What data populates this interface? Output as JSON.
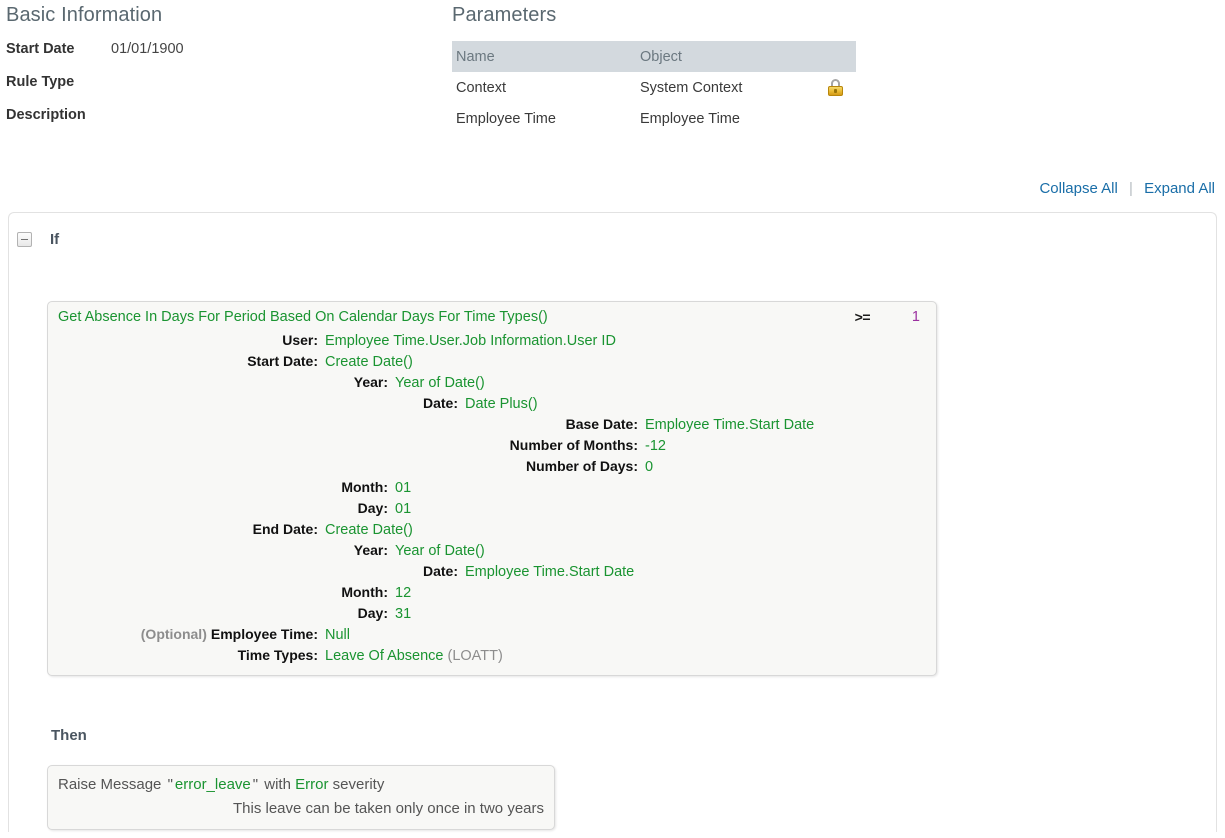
{
  "basic_information": {
    "title": "Basic Information",
    "rows": [
      {
        "label": "Start Date",
        "value": "01/01/1900"
      },
      {
        "label": "Rule Type",
        "value": ""
      },
      {
        "label": "Description",
        "value": ""
      }
    ]
  },
  "parameters": {
    "title": "Parameters",
    "columns": [
      "Name",
      "Object",
      ""
    ],
    "rows": [
      {
        "name": "Context",
        "object": "System Context",
        "locked": true,
        "lock_icon": "lock-icon"
      },
      {
        "name": "Employee Time",
        "object": "Employee Time",
        "locked": false,
        "lock_icon": ""
      }
    ]
  },
  "link_bar": {
    "collapse_all": "Collapse All",
    "expand_all": "Expand All",
    "divider": "|"
  },
  "rule": {
    "if_label": "If",
    "then_label": "Then",
    "toggle_icon": "minus-box-icon",
    "condition": {
      "function": "Get Absence In Days For Period Based On Calendar Days For Time Types()",
      "operator": ">=",
      "operand": "1",
      "args": [
        {
          "optional": "",
          "label": "User:",
          "value": "Employee Time.User.Job Information.User ID",
          "suffix": "",
          "indent": 0
        },
        {
          "optional": "",
          "label": "Start Date:",
          "value": "Create Date()",
          "suffix": "",
          "indent": 0
        },
        {
          "optional": "",
          "label": "Year:",
          "value": "Year of Date()",
          "suffix": "",
          "indent": 1
        },
        {
          "optional": "",
          "label": "Date:",
          "value": "Date Plus()",
          "suffix": "",
          "indent": 2
        },
        {
          "optional": "",
          "label": "Base Date:",
          "value": "Employee Time.Start Date",
          "suffix": "",
          "indent": 3
        },
        {
          "optional": "",
          "label": "Number of Months:",
          "value": "-12",
          "suffix": "",
          "indent": 3
        },
        {
          "optional": "",
          "label": "Number of Days:",
          "value": "0",
          "suffix": "",
          "indent": 3
        },
        {
          "optional": "",
          "label": "Month:",
          "value": "01",
          "suffix": "",
          "indent": 1
        },
        {
          "optional": "",
          "label": "Day:",
          "value": "01",
          "suffix": "",
          "indent": 1
        },
        {
          "optional": "",
          "label": "End Date:",
          "value": "Create Date()",
          "suffix": "",
          "indent": 0
        },
        {
          "optional": "",
          "label": "Year:",
          "value": "Year of Date()",
          "suffix": "",
          "indent": 1
        },
        {
          "optional": "",
          "label": "Date:",
          "value": "Employee Time.Start Date",
          "suffix": "",
          "indent": 2
        },
        {
          "optional": "",
          "label": "Month:",
          "value": "12",
          "suffix": "",
          "indent": 1
        },
        {
          "optional": "",
          "label": "Day:",
          "value": "31",
          "suffix": "",
          "indent": 1
        },
        {
          "optional": "(Optional)",
          "label": "Employee Time:",
          "value": "Null",
          "suffix": "",
          "indent": 0
        },
        {
          "optional": "",
          "label": "Time Types:",
          "value": "Leave Of Absence",
          "suffix": "(LOATT)",
          "indent": 0
        }
      ]
    },
    "action": {
      "verb": "Raise Message",
      "open_quote": "\"",
      "message_key": "error_leave",
      "close_quote": "\"",
      "with_word": "with",
      "severity": "Error",
      "severity_word": "severity",
      "message_text": "This leave can be taken only once in two years"
    }
  },
  "colors": {
    "green": "#1a9431",
    "purple": "#9b30a0",
    "link_blue": "#1a6ea8",
    "header_gray": "#d3d9de",
    "title_gray": "#5a6870"
  }
}
